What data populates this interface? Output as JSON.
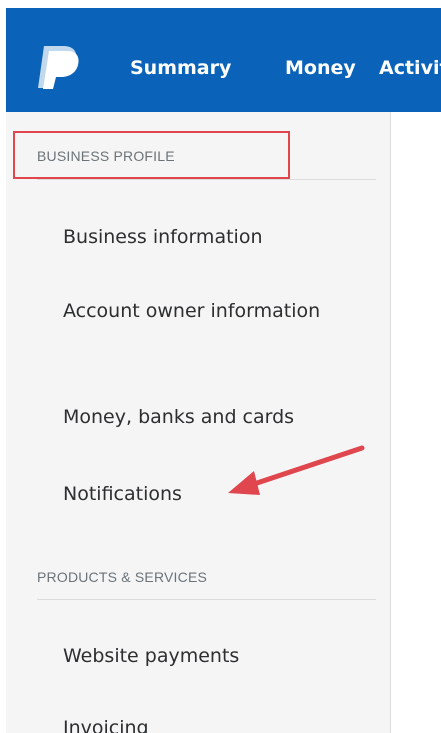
{
  "header": {
    "logo_icon": "paypal-logo-icon",
    "nav": [
      "Summary",
      "Money",
      "Activity"
    ]
  },
  "sidebar": {
    "sections": [
      {
        "title": "BUSINESS PROFILE",
        "items": [
          "Business information",
          "Account owner information",
          "Money, banks and cards",
          "Notifications"
        ]
      },
      {
        "title": "PRODUCTS & SERVICES",
        "items": [
          "Website payments",
          "Invoicing"
        ]
      }
    ]
  },
  "annotations": {
    "highlight_color": "#e0464d",
    "arrow_color": "#e0464d",
    "arrow_target": "Notifications"
  },
  "colors": {
    "header_bg": "#0a63b8",
    "sidebar_bg": "#f5f5f5"
  }
}
